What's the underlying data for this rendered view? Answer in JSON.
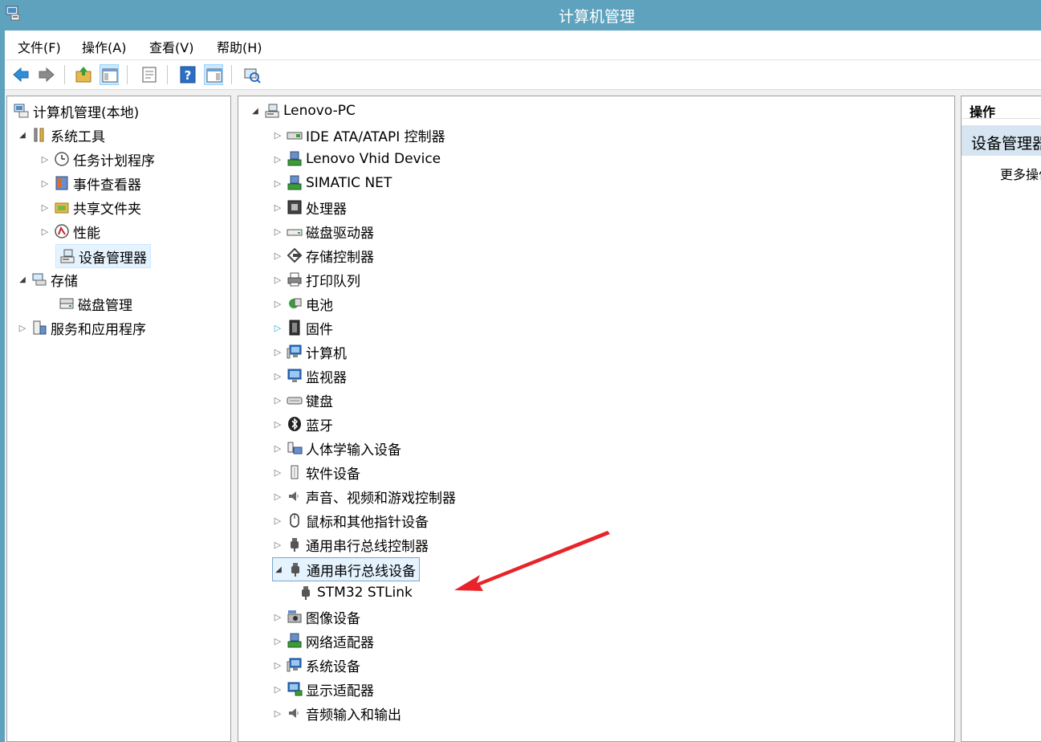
{
  "window": {
    "title": "计算机管理"
  },
  "menu": [
    "文件(F)",
    "操作(A)",
    "查看(V)",
    "帮助(H)"
  ],
  "left_tree": [
    {
      "label": "计算机管理(本地)",
      "icon": "computer-management-icon",
      "expander": ""
    },
    {
      "label": "系统工具",
      "icon": "tools-icon",
      "expander": "expanded"
    },
    {
      "label": "任务计划程序",
      "icon": "clock-icon",
      "expander": "collapsed"
    },
    {
      "label": "事件查看器",
      "icon": "event-viewer-icon",
      "expander": "collapsed"
    },
    {
      "label": "共享文件夹",
      "icon": "shared-folder-icon",
      "expander": "collapsed"
    },
    {
      "label": "性能",
      "icon": "performance-icon",
      "expander": "collapsed"
    },
    {
      "label": "设备管理器",
      "icon": "device-manager-icon",
      "expander": ""
    },
    {
      "label": "存储",
      "icon": "storage-icon",
      "expander": "expanded"
    },
    {
      "label": "磁盘管理",
      "icon": "disk-icon",
      "expander": ""
    },
    {
      "label": "服务和应用程序",
      "icon": "services-icon",
      "expander": "collapsed"
    }
  ],
  "device_tree": {
    "root": "Lenovo-PC",
    "categories": [
      {
        "label": "IDE ATA/ATAPI 控制器",
        "icon": "ide-controller-icon"
      },
      {
        "label": "Lenovo Vhid Device",
        "icon": "network-device-icon"
      },
      {
        "label": "SIMATIC NET",
        "icon": "network-device-icon"
      },
      {
        "label": "处理器",
        "icon": "processor-icon"
      },
      {
        "label": "磁盘驱动器",
        "icon": "disk-drive-icon"
      },
      {
        "label": "存储控制器",
        "icon": "storage-controller-icon"
      },
      {
        "label": "打印队列",
        "icon": "printer-icon"
      },
      {
        "label": "电池",
        "icon": "battery-icon"
      },
      {
        "label": "固件",
        "icon": "firmware-icon"
      },
      {
        "label": "计算机",
        "icon": "computer-icon"
      },
      {
        "label": "监视器",
        "icon": "monitor-icon"
      },
      {
        "label": "键盘",
        "icon": "keyboard-icon"
      },
      {
        "label": "蓝牙",
        "icon": "bluetooth-icon"
      },
      {
        "label": "人体学输入设备",
        "icon": "hid-icon"
      },
      {
        "label": "软件设备",
        "icon": "software-device-icon"
      },
      {
        "label": "声音、视频和游戏控制器",
        "icon": "speaker-icon"
      },
      {
        "label": "鼠标和其他指针设备",
        "icon": "mouse-icon"
      },
      {
        "label": "通用串行总线控制器",
        "icon": "usb-icon"
      },
      {
        "label": "通用串行总线设备",
        "icon": "usb-icon"
      },
      {
        "label": "STM32 STLink",
        "icon": "usb-icon"
      },
      {
        "label": "图像设备",
        "icon": "camera-icon"
      },
      {
        "label": "网络适配器",
        "icon": "network-device-icon"
      },
      {
        "label": "系统设备",
        "icon": "computer-icon"
      },
      {
        "label": "显示适配器",
        "icon": "display-adapter-icon"
      },
      {
        "label": "音频输入和输出",
        "icon": "speaker-icon"
      }
    ]
  },
  "actions": {
    "header": "操作",
    "section": "设备管理器",
    "more": "更多操作"
  },
  "colors": {
    "title_bar": "#5ea2be",
    "annotation_arrow": "#e8232a",
    "selection": "#e5f3ff"
  }
}
